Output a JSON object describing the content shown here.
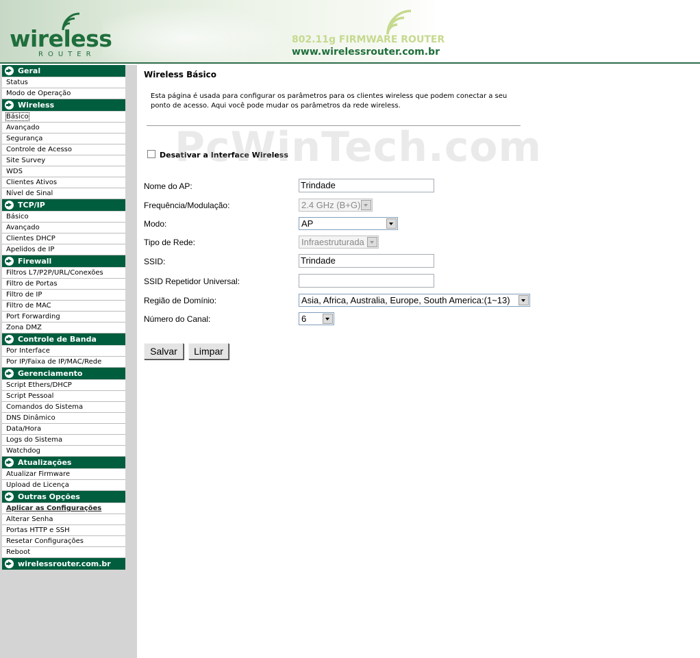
{
  "header": {
    "logo_text": "wireless",
    "logo_sub": "ROUTER",
    "banner_title": "802.11g FIRMWARE ROUTER",
    "banner_url": "www.wirelessrouter.com.br"
  },
  "sidebar": {
    "sections": [
      {
        "title": "Geral",
        "items": [
          "Status",
          "Modo de Operação"
        ]
      },
      {
        "title": "Wireless",
        "items": [
          "Básico",
          "Avançado",
          "Segurança",
          "Controle de Acesso",
          "Site Survey",
          "WDS",
          "Clientes Ativos",
          "Nível de Sinal"
        ]
      },
      {
        "title": "TCP/IP",
        "items": [
          "Básico",
          "Avançado",
          "Clientes DHCP",
          "Apelidos de IP"
        ]
      },
      {
        "title": "Firewall",
        "items": [
          "Filtros L7/P2P/URL/Conexões",
          "Filtro de Portas",
          "Filtro de IP",
          "Filtro de MAC",
          "Port Forwarding",
          "Zona DMZ"
        ]
      },
      {
        "title": "Controle de Banda",
        "items": [
          "Por Interface",
          "Por IP/Faixa de IP/MAC/Rede"
        ]
      },
      {
        "title": "Gerenciamento",
        "items": [
          "Script Ethers/DHCP",
          "Script Pessoal",
          "Comandos do Sistema",
          "DNS Dinâmico",
          "Data/Hora",
          "Logs do Sistema",
          "Watchdog"
        ]
      },
      {
        "title": "Atualizações",
        "items": [
          "Atualizar Firmware",
          "Upload de Licença"
        ]
      },
      {
        "title": "Outras Opções",
        "items": [
          "Aplicar as Configurações",
          "Alterar Senha",
          "Portas HTTP e SSH",
          "Resetar Configurações",
          "Reboot"
        ]
      },
      {
        "title": "wirelessrouter.com.br",
        "items": []
      }
    ]
  },
  "main": {
    "title": "Wireless Básico",
    "description": "Esta página é usada para configurar os parâmetros para os clientes wireless que podem conectar a seu ponto de acesso. Aqui você pode mudar os parâmetros da rede wireless.",
    "disable_label": "Desativar a Interface Wireless",
    "fields": {
      "ap_name_label": "Nome do AP:",
      "ap_name_value": "Trindade",
      "frequency_label": "Frequência/Modulação:",
      "frequency_value": "2.4 GHz (B+G)",
      "mode_label": "Modo:",
      "mode_value": "AP",
      "network_type_label": "Tipo de Rede:",
      "network_type_value": "Infraestruturada",
      "ssid_label": "SSID:",
      "ssid_value": "Trindade",
      "repeater_ssid_label": "SSID Repetidor Universal:",
      "repeater_ssid_value": "",
      "domain_label": "Região de Domínio:",
      "domain_value": "Asia, Africa, Australia, Europe, South America:(1~13)",
      "channel_label": "Número do Canal:",
      "channel_value": "6"
    },
    "buttons": {
      "save": "Salvar",
      "clear": "Limpar"
    }
  },
  "watermark": "PcWinTech.com",
  "colors": {
    "menu_header": "#005d3d",
    "sidebar_bg": "#d4d4d4",
    "brand_green": "#1f6e3c"
  }
}
